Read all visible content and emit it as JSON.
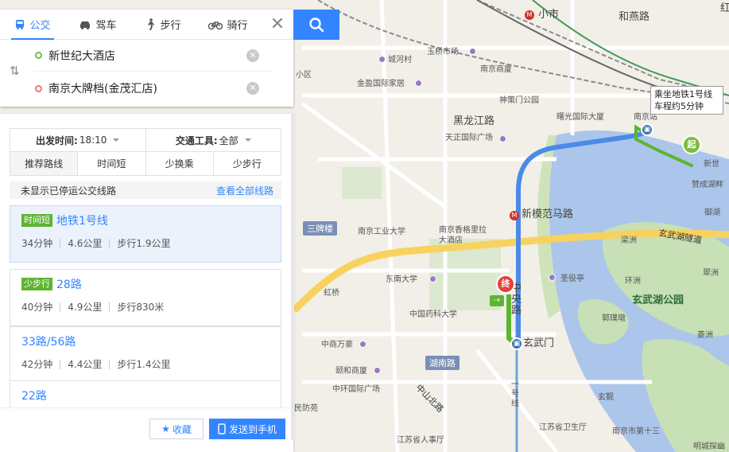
{
  "tabs": [
    {
      "label": "公交",
      "icon": "bus-icon"
    },
    {
      "label": "驾车",
      "icon": "car-icon"
    },
    {
      "label": "步行",
      "icon": "walk-icon"
    },
    {
      "label": "骑行",
      "icon": "bike-icon"
    }
  ],
  "route": {
    "from": "新世纪大酒店",
    "to": "南京大牌档(金茂汇店)"
  },
  "filters": {
    "depart_label": "出发时间:",
    "depart_value": "18:10",
    "tool_label": "交通工具:",
    "tool_value": "全部"
  },
  "sort_tabs": [
    "推荐路线",
    "时间短",
    "少换乘",
    "少步行"
  ],
  "notice": {
    "text": "未显示已停运公交线路",
    "link": "查看全部线路"
  },
  "routes": [
    {
      "tag": "时间短",
      "name": "地铁1号线",
      "time": "34分钟",
      "distance": "4.6公里",
      "walk": "步行1.9公里"
    },
    {
      "tag": "少步行",
      "name": "28路",
      "time": "40分钟",
      "distance": "4.9公里",
      "walk": "步行830米"
    },
    {
      "tag": "",
      "name": "33路/56路",
      "time": "42分钟",
      "distance": "4.4公里",
      "walk": "步行1.4公里"
    },
    {
      "tag": "",
      "name": "22路",
      "time": "",
      "distance": "",
      "walk": ""
    }
  ],
  "footer": {
    "fav": "收藏",
    "send": "发送到手机"
  },
  "map": {
    "tip_line1": "乘坐地铁1号线",
    "tip_line2": "车程约5分钟",
    "start": "起",
    "end": "终",
    "walk_glyph": "⇢",
    "labels": {
      "xiaoshi": "小市",
      "heyanlu": "和燕路",
      "hong": "红",
      "chengheicun": "城河村",
      "yuqiaoshichang": "玉桥市场",
      "nanjingshangsha": "南京商厦",
      "jinyingguoji": "金盈国际家居",
      "xiaoqu": "小区",
      "shenceMen": "神策门公园",
      "shuguang": "曙光国际大厦",
      "nanjingzhan": "南京站",
      "heilongjianglu": "黑龙江路",
      "tianzheng": "天正国际广场",
      "xinshiji": "新世",
      "zanchenghupan": "赞成湖畔",
      "yuhu": "御湖",
      "xinmofanmalu": "新模范马路",
      "sanpailou": "三牌楼",
      "nanjinggongye": "南京工业大学",
      "xianggeli1": "南京香格里拉",
      "xianggeli2": "大酒店",
      "xuanwuhusuidao": "玄武湖隧道",
      "liangzhou": "梁洲",
      "cuizhou": "翠洲",
      "dongnan": "东南大学",
      "zhongyanglu": "中央路",
      "shengting": "圣役亭",
      "huanzhou": "环洲",
      "xuanwuhugongyuan": "玄武湖公园",
      "hongqiao": "虹桥",
      "yaokedaxue": "中国药科大学",
      "guojingdun": "郭璞墩",
      "xuanwumen": "玄武门",
      "lingzhou": "菱洲",
      "zhongshanwanxiang": "中商万豪",
      "hunanlu": "湖南路",
      "yihesheng": "颐和商厦",
      "zhonghuan": "中环国际广场",
      "zhongshanbeilu": "中山北路",
      "yinxiang": "一号线",
      "yuanfangyuan": "民防苑",
      "xuanmiao": "玄觐",
      "jiangsuweisheng": "江苏省卫生厅",
      "diyisanyiyuan": "南京市第十三",
      "jiangsurenshi": "江苏省人事厅",
      "mingcheng": "明城探幽"
    }
  }
}
